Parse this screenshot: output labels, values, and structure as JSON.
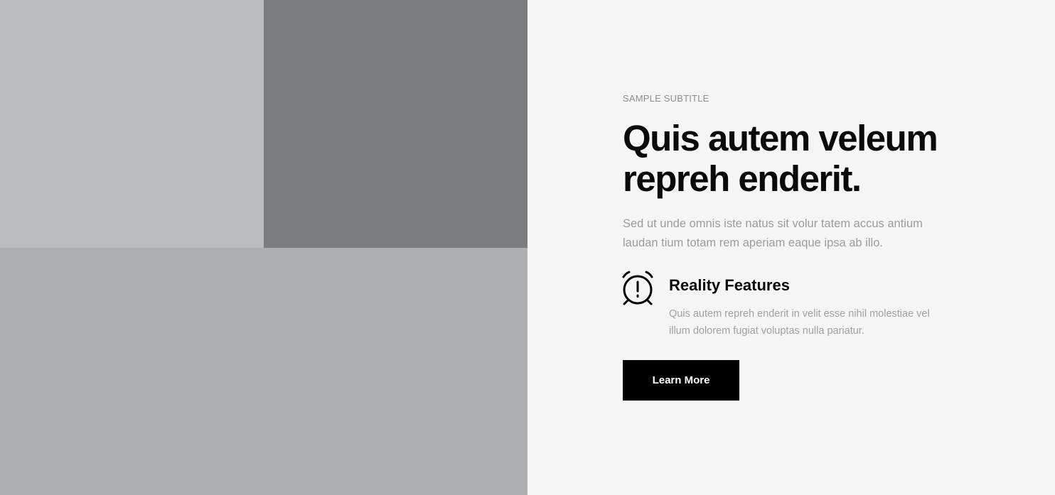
{
  "section": {
    "subtitle": "SAMPLE SUBTITLE",
    "heading": "Quis autem veleum repreh enderit.",
    "lead": "Sed ut unde omnis iste natus sit volur tatem accus antium laudan tium totam rem aperiam eaque ipsa ab illo.",
    "feature": {
      "icon": "alarm-clock-icon",
      "title": "Reality Features",
      "text": "Quis autem repreh enderit in velit esse nihil molestiae vel illum dolorem fugiat voluptas nulla pariatur."
    },
    "cta_label": "Learn More"
  },
  "colors": {
    "page_background": "#f5f5f5",
    "heading": "#0a0a0a",
    "muted_text": "#9c9c9c",
    "button_background": "#000000",
    "button_text": "#ffffff",
    "tile_light": "#bbbcbe",
    "tile_dark": "#7b7c7e",
    "tile_medium": "#aeafb0"
  }
}
